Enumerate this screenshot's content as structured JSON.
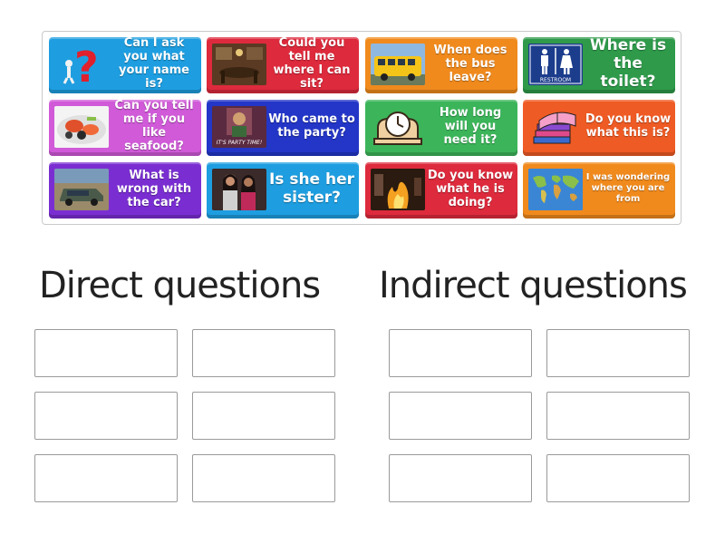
{
  "cards": [
    {
      "id": "ask-name",
      "text": "Can I ask you what your name is?",
      "color": "#1e9ee0",
      "icon": "question-mark-icon"
    },
    {
      "id": "where-sit",
      "text": "Could you tell me where I can sit?",
      "color": "#dd2a3c",
      "icon": "dining-room-photo"
    },
    {
      "id": "bus-leave",
      "text": "When does the bus leave?",
      "color": "#f08a1d",
      "icon": "school-bus-photo"
    },
    {
      "id": "toilet",
      "text": "Where is the toilet?",
      "color": "#2e9a4a",
      "icon": "restroom-sign-icon"
    },
    {
      "id": "seafood",
      "text": "Can you tell me if you like seafood?",
      "color": "#d05ad8",
      "icon": "seafood-platter-photo"
    },
    {
      "id": "party",
      "text": "Who came to the party?",
      "color": "#2336c7",
      "icon": "party-scene-photo"
    },
    {
      "id": "how-long",
      "text": "How long will you need it?",
      "color": "#3cb55a",
      "icon": "mantel-clock-icon"
    },
    {
      "id": "this-is",
      "text": "Do you know what this is?",
      "color": "#ef5b24",
      "icon": "books-icon"
    },
    {
      "id": "car",
      "text": "What is wrong with the car?",
      "color": "#7a2ed2",
      "icon": "car-photo"
    },
    {
      "id": "sister",
      "text": "Is she her sister?",
      "color": "#1e9ee0",
      "icon": "two-women-photo"
    },
    {
      "id": "doing",
      "text": "Do you know what he is doing?",
      "color": "#dd2a3c",
      "icon": "fire-cooking-photo"
    },
    {
      "id": "from",
      "text": "I was wondering where you are from",
      "color": "#f08a1d",
      "icon": "world-map-icon"
    }
  ],
  "restroom_label": "RESTROOM",
  "party_caption": "IT'S PARTY TIME!",
  "groups": {
    "direct": {
      "title": "Direct questions"
    },
    "indirect": {
      "title": "Indirect questions"
    }
  }
}
